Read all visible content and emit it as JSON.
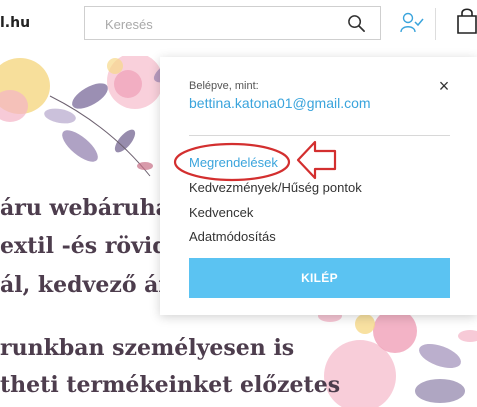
{
  "header": {
    "logo_text": "l.hu",
    "search_placeholder": "Keresés"
  },
  "hero": {
    "lines": [
      "áru webáruha",
      "extil -és rövid",
      "ál, kedvező ár",
      "runkban személyesen is",
      "theti termékeinket előzetes"
    ]
  },
  "account_panel": {
    "logged_in_label": "Belépve, mint:",
    "email": "bettina.katona01@gmail.com",
    "menu": [
      {
        "label": "Megrendelések"
      },
      {
        "label": "Kedvezmények/Hűség pontok"
      },
      {
        "label": "Kedvencek"
      },
      {
        "label": "Adatmódosítás"
      }
    ],
    "logout_label": "KILÉP",
    "close_glyph": "×"
  },
  "colors": {
    "accent": "#3aa4dc",
    "logout_button": "#5bc3f2",
    "annotation": "#d32f2f",
    "hero_text": "#4d3d4d"
  }
}
